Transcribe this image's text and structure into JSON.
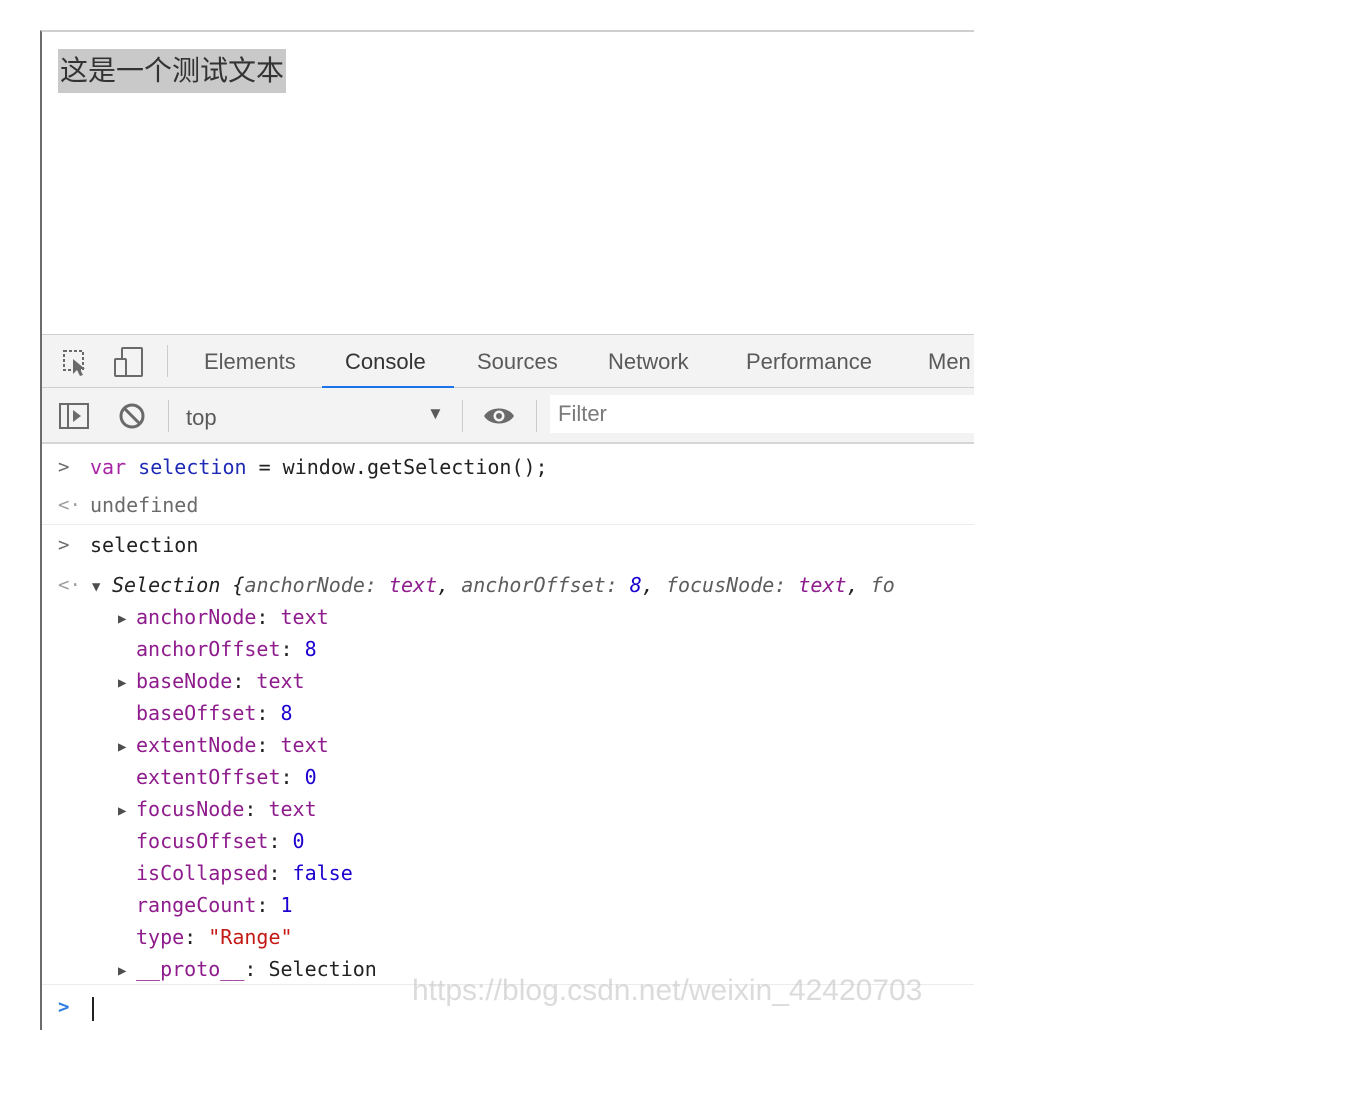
{
  "page": {
    "text": "这是一个测试文本"
  },
  "devtools": {
    "tabs": [
      {
        "label": "Elements"
      },
      {
        "label": "Console"
      },
      {
        "label": "Sources"
      },
      {
        "label": "Network"
      },
      {
        "label": "Performance"
      },
      {
        "label": "Men"
      }
    ],
    "active_tab": "Console",
    "icons": [
      "inspect-element-icon",
      "device-toolbar-icon",
      "sidebar-toggle-icon",
      "clear-console-icon",
      "eye-icon"
    ],
    "context": "top",
    "filter_placeholder": "Filter"
  },
  "console": {
    "input1": {
      "kw": "var",
      "name": "selection",
      "op": " = ",
      "rest": "window.getSelection();"
    },
    "result1": "undefined",
    "input2": "selection",
    "summary": {
      "head": "Selection {",
      "k1": "anchorNode: ",
      "v1": "text",
      "comma1": ", ",
      "k2": "anchorOffset: ",
      "v2": "8",
      "comma2": ", ",
      "k3": "focusNode: ",
      "v3": "text",
      "comma3": ", ",
      "k4": "fo"
    },
    "props": [
      {
        "key": "anchorNode",
        "sep": ": ",
        "value": "text",
        "expandable": true,
        "kind": "obj-key"
      },
      {
        "key": "anchorOffset",
        "sep": ": ",
        "value": "8",
        "expandable": false,
        "kind": "num"
      },
      {
        "key": "baseNode",
        "sep": ": ",
        "value": "text",
        "expandable": true,
        "kind": "obj-key"
      },
      {
        "key": "baseOffset",
        "sep": ": ",
        "value": "8",
        "expandable": false,
        "kind": "num"
      },
      {
        "key": "extentNode",
        "sep": ": ",
        "value": "text",
        "expandable": true,
        "kind": "obj-key"
      },
      {
        "key": "extentOffset",
        "sep": ": ",
        "value": "0",
        "expandable": false,
        "kind": "num"
      },
      {
        "key": "focusNode",
        "sep": ": ",
        "value": "text",
        "expandable": true,
        "kind": "obj-key"
      },
      {
        "key": "focusOffset",
        "sep": ": ",
        "value": "0",
        "expandable": false,
        "kind": "num"
      },
      {
        "key": "isCollapsed",
        "sep": ": ",
        "value": "false",
        "expandable": false,
        "kind": "num"
      },
      {
        "key": "rangeCount",
        "sep": ": ",
        "value": "1",
        "expandable": false,
        "kind": "num"
      },
      {
        "key": "type",
        "sep": ": ",
        "value": "\"Range\"",
        "expandable": false,
        "kind": "str"
      },
      {
        "key": "__proto__",
        "sep": ": ",
        "value": "Selection",
        "expandable": true,
        "kind": "plain"
      }
    ]
  },
  "watermark": "https://blog.csdn.net/weixin_42420703",
  "colors": {
    "active_tab_underline": "#1a73e8",
    "selection_highlight": "#c9c9c9",
    "keyword": "#a626a4",
    "property_key": "#8e1c8c",
    "number": "#1c00cf",
    "string": "#c41a16"
  }
}
